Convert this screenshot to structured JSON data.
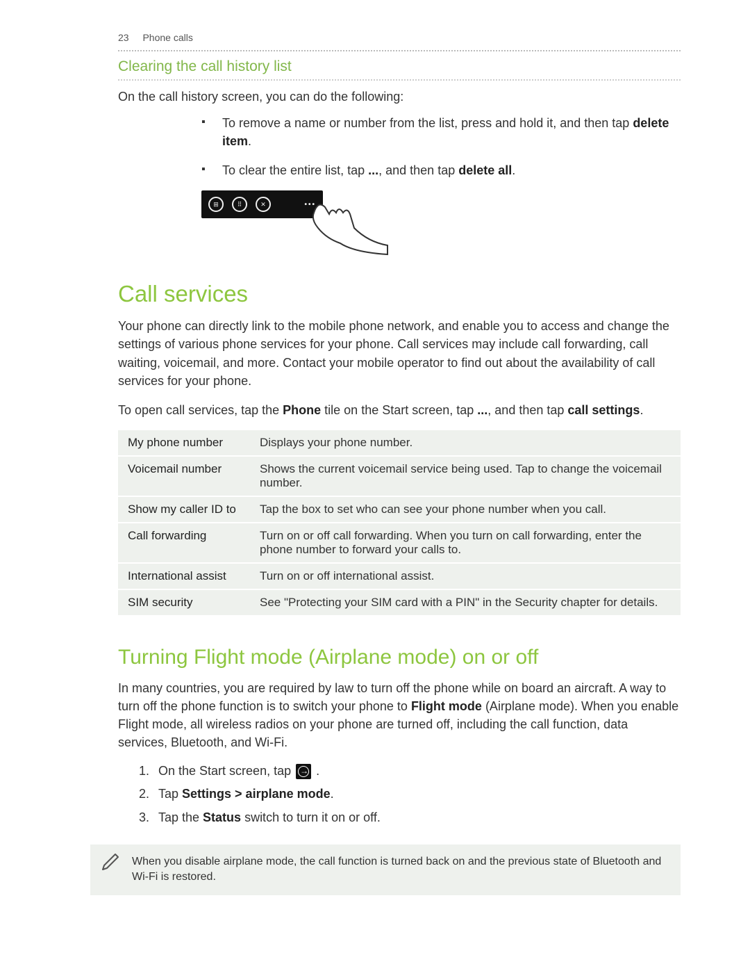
{
  "header": {
    "page_number": "23",
    "section": "Phone calls"
  },
  "clearing": {
    "title": "Clearing the call history list",
    "intro": "On the call history screen, you can do the following:",
    "bullets": [
      {
        "pre": "To remove a name or number from the list, press and hold it, and then tap ",
        "bold": "delete item",
        "post": "."
      },
      {
        "pre": "To clear the entire list, tap ",
        "mid": "...",
        "post1": ", and then tap ",
        "bold": "delete all",
        "post2": "."
      }
    ]
  },
  "call_services": {
    "title": "Call services",
    "para1": "Your phone can directly link to the mobile phone network, and enable you to access and change the settings of various phone services for your phone. Call services may include call forwarding, call waiting, voicemail, and more. Contact your mobile operator to find out about the availability of call services for your phone.",
    "open_pre": "To open call services, tap the ",
    "open_bold1": "Phone",
    "open_mid1": " tile on the Start screen, tap ",
    "open_dots": "...",
    "open_mid2": ", and then tap ",
    "open_bold2": "call settings",
    "open_post": ".",
    "rows": [
      {
        "label": "My phone number",
        "desc": "Displays your phone number."
      },
      {
        "label": "Voicemail number",
        "desc": "Shows the current voicemail service being used. Tap to change the voicemail number."
      },
      {
        "label": "Show my caller ID to",
        "desc": "Tap the box to set who can see your phone number when you call."
      },
      {
        "label": "Call forwarding",
        "desc": "Turn on or off call forwarding. When you turn on call forwarding, enter the phone number to forward your calls to."
      },
      {
        "label": "International assist",
        "desc": "Turn on or off international assist."
      },
      {
        "label": "SIM security",
        "desc": "See \"Protecting your SIM card with a PIN\" in the Security chapter for details."
      }
    ]
  },
  "flight": {
    "title": "Turning Flight mode (Airplane mode) on or off",
    "para_pre": "In many countries, you are required by law to turn off the phone while on board an aircraft. A way to turn off the phone function is to switch your phone to ",
    "para_bold": "Flight mode",
    "para_post": " (Airplane mode). When you enable Flight mode, all wireless radios on your phone are turned off, including the call function, data services, Bluetooth, and Wi-Fi.",
    "steps": {
      "s1_num": "1.",
      "s1_pre": "On the Start screen, tap ",
      "s1_post": " .",
      "s2_num": "2.",
      "s2_pre": "Tap ",
      "s2_bold": "Settings > airplane mode",
      "s2_post": ".",
      "s3_num": "3.",
      "s3_pre": "Tap the ",
      "s3_bold": "Status",
      "s3_post": " switch to turn it on or off."
    },
    "note": "When you disable airplane mode, the call function is turned back on and the previous state of Bluetooth and Wi-Fi is restored."
  }
}
